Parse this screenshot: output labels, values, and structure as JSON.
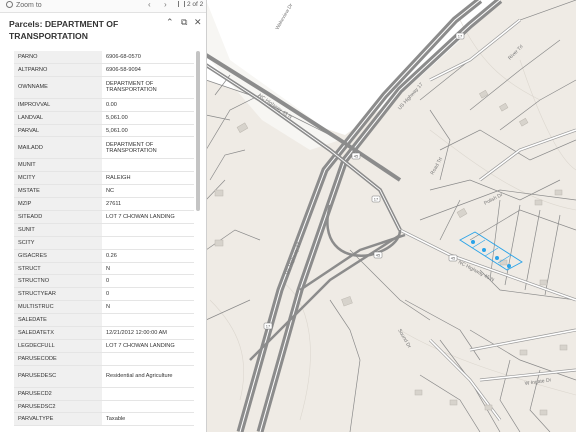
{
  "toolbar": {
    "zoom_label": "Zoom to",
    "prev": "‹",
    "next": "›",
    "pager": "2 of 2"
  },
  "popup": {
    "title": "Parcels: DEPARTMENT OF TRANSPORTATION",
    "rows": [
      {
        "key": "PARNO",
        "value": "6906-68-0570"
      },
      {
        "key": "ALTPARNO",
        "value": "6906-58-9094"
      },
      {
        "key": "OWNNAME",
        "value": "DEPARTMENT OF TRANSPORTATION"
      },
      {
        "key": "IMPROVVAL",
        "value": "0.00"
      },
      {
        "key": "LANDVAL",
        "value": "5,061.00"
      },
      {
        "key": "PARVAL",
        "value": "5,061.00"
      },
      {
        "key": "MAILADD",
        "value": "DEPARTMENT OF TRANSPORTATION"
      },
      {
        "key": "MUNIT",
        "value": ""
      },
      {
        "key": "MCITY",
        "value": "RALEIGH"
      },
      {
        "key": "MSTATE",
        "value": "NC"
      },
      {
        "key": "MZIP",
        "value": "27611"
      },
      {
        "key": "SITEADD",
        "value": "LOT 7 CHOWAN LANDING"
      },
      {
        "key": "SUNIT",
        "value": ""
      },
      {
        "key": "SCITY",
        "value": ""
      },
      {
        "key": "GISACRES",
        "value": "0.26"
      },
      {
        "key": "STRUCT",
        "value": "N"
      },
      {
        "key": "STRUCTNO",
        "value": "0"
      },
      {
        "key": "STRUCTYEAR",
        "value": "0"
      },
      {
        "key": "MULTISTRUC",
        "value": "N"
      },
      {
        "key": "SALEDATE",
        "value": ""
      },
      {
        "key": "SALEDATETX",
        "value": "12/21/2012 12:00:00 AM"
      },
      {
        "key": "LEGDECFULL",
        "value": "LOT 7 CHOWAN LANDING"
      },
      {
        "key": "PARUSECODE",
        "value": ""
      },
      {
        "key": "PARUSEDESC",
        "value": "Residential and Agriculture"
      },
      {
        "key": "PARUSECD2",
        "value": ""
      },
      {
        "key": "PARUSEDSC2",
        "value": ""
      },
      {
        "key": "PARVALTYPE",
        "value": "Taxable"
      }
    ]
  },
  "map": {
    "labels": {
      "wakeview": "Wakeview Dr",
      "nc_highway_45_n": "NC Highway 45 N",
      "nc_highway_45_n_2": "NC Highway 45 N",
      "us17": "US Highway 17",
      "us17_2": "US Highway 17",
      "rivertrl": "River Trl",
      "roadtrl": "Road Trl",
      "polishtrl": "Polish Dr",
      "wingate": "W Ingate Dr",
      "sound": "Sound Dr"
    },
    "shields": [
      "17",
      "45",
      "17",
      "45",
      "17",
      "45"
    ],
    "colors": {
      "land": "#efebe5",
      "water_white": "#ffffff",
      "highway": "#8c8c8c",
      "road": "#8a8a8a",
      "selection": "#2aa3e8"
    }
  }
}
